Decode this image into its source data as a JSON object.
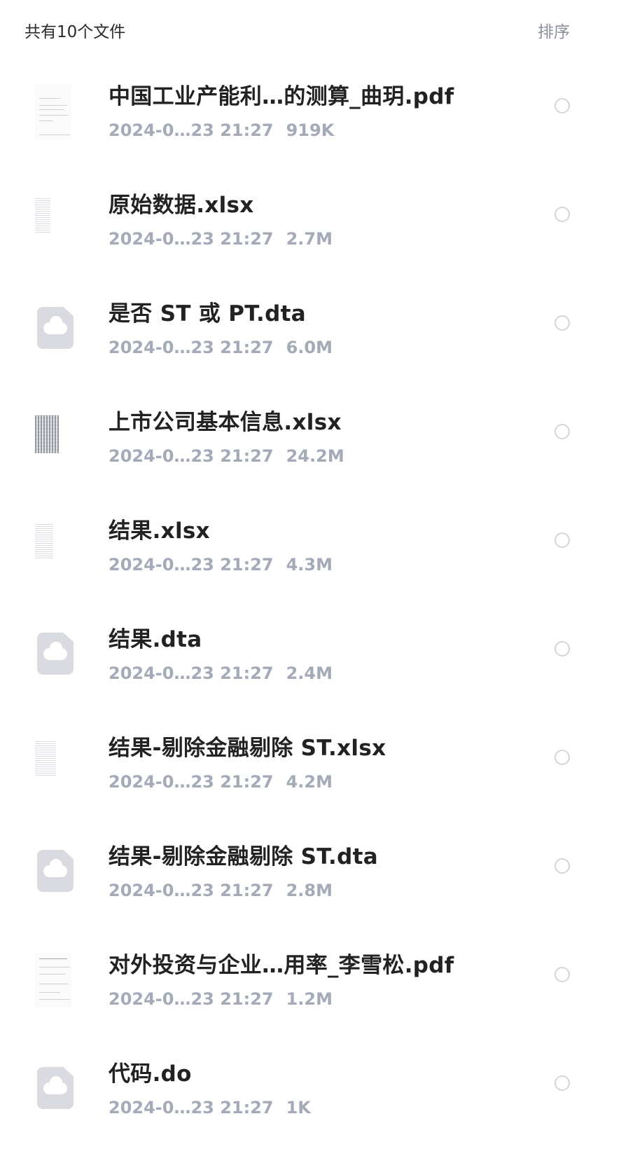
{
  "header": {
    "count_label": "共有10个文件",
    "sort_label": "排序"
  },
  "files": [
    {
      "name": "中国工业产能利…的测算_曲玥.pdf",
      "date": "2024-0…23 21:27",
      "size": "919K",
      "thumb": "pdf-thumbnail"
    },
    {
      "name": "原始数据.xlsx",
      "date": "2024-0…23 21:27",
      "size": "2.7M",
      "thumb": "spreadsheet-thumbnail"
    },
    {
      "name": "是否 ST 或 PT.dta",
      "date": "2024-0…23 21:27",
      "size": "6.0M",
      "thumb": "cloud-file-icon"
    },
    {
      "name": "上市公司基本信息.xlsx",
      "date": "2024-0…23 21:27",
      "size": "24.2M",
      "thumb": "spreadsheet-thumbnail"
    },
    {
      "name": "结果.xlsx",
      "date": "2024-0…23 21:27",
      "size": "4.3M",
      "thumb": "spreadsheet-thumbnail"
    },
    {
      "name": "结果.dta",
      "date": "2024-0…23 21:27",
      "size": "2.4M",
      "thumb": "cloud-file-icon"
    },
    {
      "name": "结果-剔除金融剔除 ST.xlsx",
      "date": "2024-0…23 21:27",
      "size": "4.2M",
      "thumb": "spreadsheet-thumbnail"
    },
    {
      "name": "结果-剔除金融剔除 ST.dta",
      "date": "2024-0…23 21:27",
      "size": "2.8M",
      "thumb": "cloud-file-icon"
    },
    {
      "name": "对外投资与企业…用率_李雪松.pdf",
      "date": "2024-0…23 21:27",
      "size": "1.2M",
      "thumb": "pdf-thumbnail"
    },
    {
      "name": "代码.do",
      "date": "2024-0…23 21:27",
      "size": "1K",
      "thumb": "cloud-file-icon"
    }
  ],
  "colors": {
    "title_text": "#222222",
    "meta_text": "#a4aab8",
    "sort_text": "#8a8f99",
    "radio_border": "#d3d5da",
    "cloud_icon_bg": "#d9dbe0"
  }
}
